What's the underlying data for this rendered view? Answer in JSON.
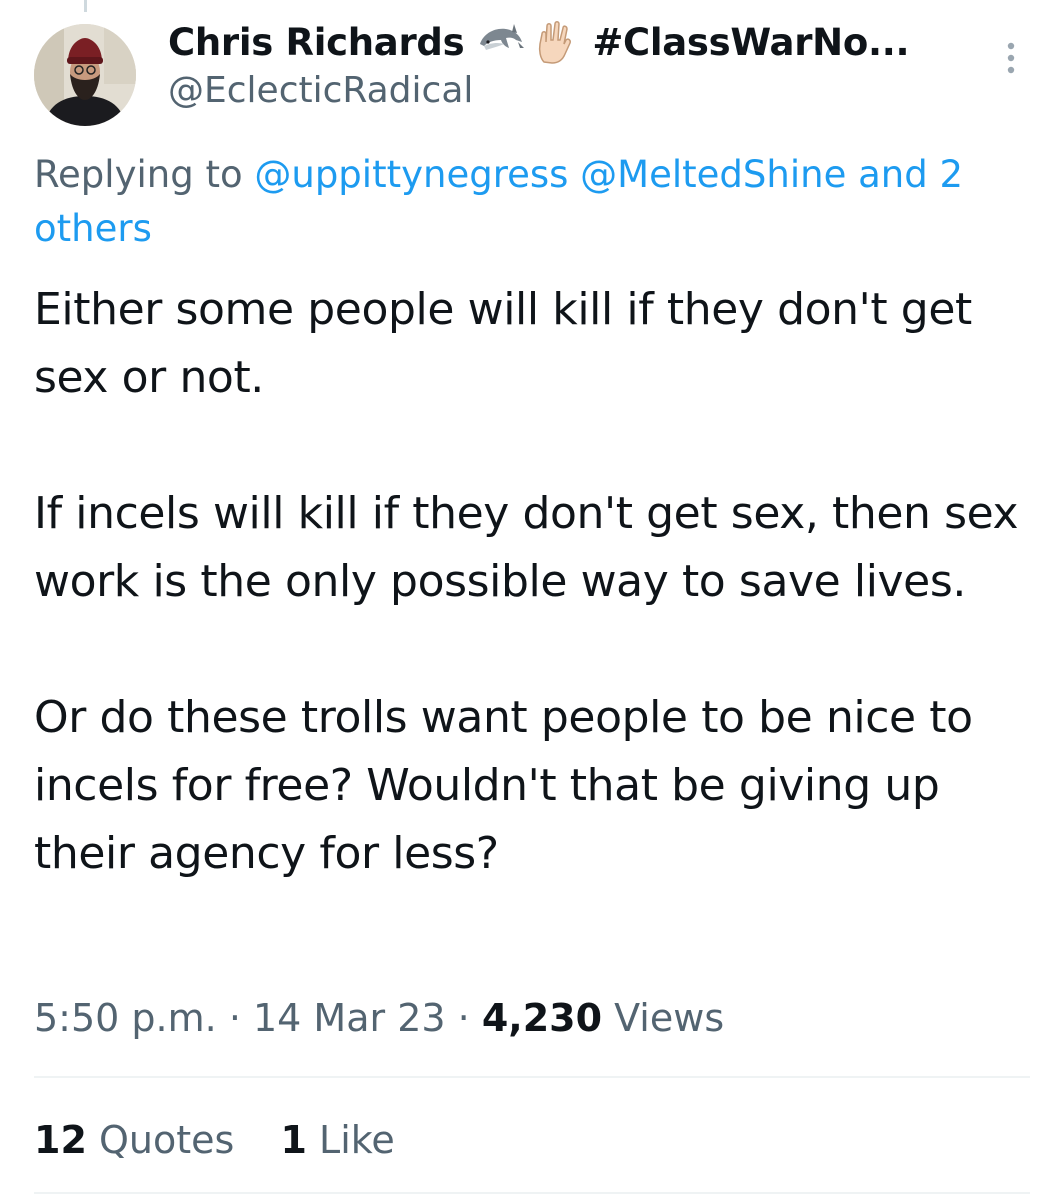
{
  "tweet": {
    "display_name": "Chris Richards",
    "name_suffix": "#ClassWarNo...",
    "handle": "@EclecticRadical",
    "reply_prefix": "Replying to",
    "reply_mentions": [
      "@uppittynegress",
      "@MeltedShine"
    ],
    "reply_joiner": "and",
    "reply_others": "2 others",
    "text": "Either some people will kill if they don't get sex or not.\n\nIf incels will kill if they don't get sex, then sex work is the only possible way to save lives.\n\nOr do these trolls want people to be nice to incels for free? Wouldn't that be giving up their agency for less?",
    "time": "5:50 p.m.",
    "date": "14 Mar 23",
    "separator": "·",
    "views_count": "4,230",
    "views_label": "Views"
  },
  "stats": {
    "quotes_count": "12",
    "quotes_label": "Quotes",
    "likes_count": "1",
    "likes_label": "Like"
  },
  "icons": {
    "name_emoji_1": "dolphin-icon",
    "name_emoji_2": "vulcan-salute-icon",
    "more": "more-options-icon"
  },
  "colors": {
    "text": "#0f1419",
    "secondary": "#536471",
    "link": "#1d9bf0",
    "divider": "#eff3f4"
  }
}
